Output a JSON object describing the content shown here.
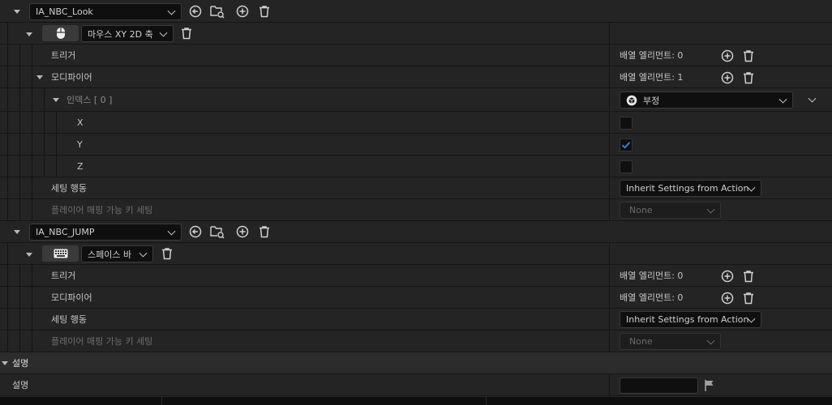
{
  "mapping1": {
    "action_value": "IA_NBC_Look",
    "key_label": "마우스 XY 2D 축",
    "trigger_label": "트리거",
    "trigger_count": "배열 엘리먼트: 0",
    "modifier_label": "모디파이어",
    "modifier_count": "배열 엘리먼트: 1",
    "index_label": "인덱스 [ 0 ]",
    "negate_value": "부정",
    "x_label": "X",
    "y_label": "Y",
    "z_label": "Z",
    "x_checked": false,
    "y_checked": true,
    "z_checked": false,
    "settings_label": "세팅 행동",
    "settings_value": "Inherit Settings from Action",
    "player_label": "플레이어 매핑 가능 키 세팅",
    "player_value": "None"
  },
  "mapping2": {
    "action_value": "IA_NBC_JUMP",
    "key_label": "스페이스 바",
    "trigger_label": "트리거",
    "trigger_count": "배열 엘리먼트: 0",
    "modifier_label": "모디파이어",
    "modifier_count": "배열 엘리먼트: 0",
    "settings_label": "세팅 행동",
    "settings_value": "Inherit Settings from Action",
    "player_label": "플레이어 매핑 가능 키 세팅",
    "player_value": "None"
  },
  "description": {
    "section_label": "설명",
    "field_label": "설명",
    "value": ""
  },
  "colors": {
    "accent_check": "#2f7bd6",
    "row_bg": "#242424",
    "panel_bg": "#151515"
  },
  "icons": [
    "chevron-down-icon",
    "reset-arrow-icon",
    "browse-folder-icon",
    "add-circle-icon",
    "trash-icon",
    "mouse-icon",
    "keyboard-icon",
    "negate-icon",
    "flag-icon"
  ]
}
